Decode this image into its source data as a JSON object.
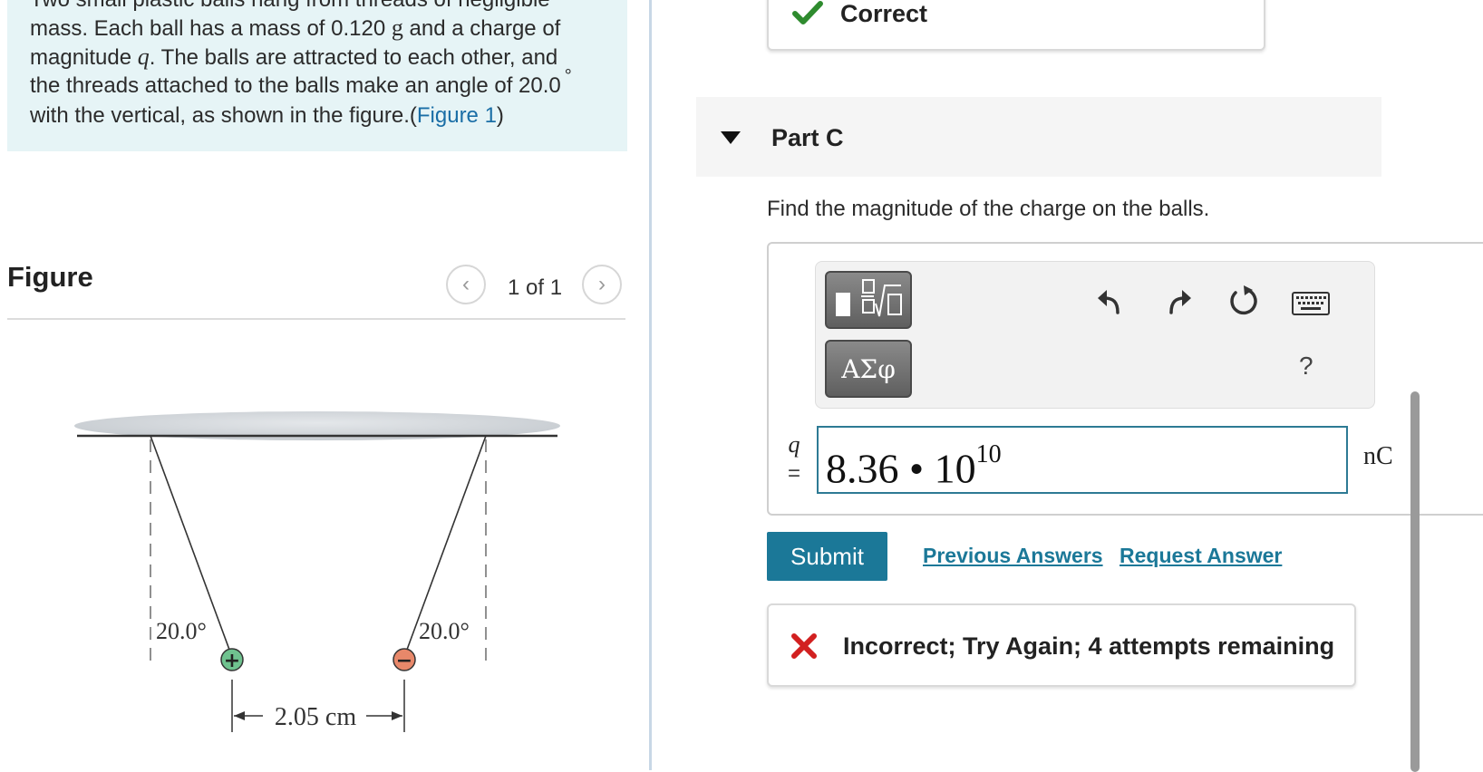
{
  "problem": {
    "line1": "Two small plastic balls hang from threads of negligible",
    "line2_a": "mass. Each ball has a mass of 0.120 ",
    "line2_unit": "g",
    "line2_b": " and a charge of",
    "line3_a": "magnitude ",
    "line3_var": "q",
    "line3_b": ". The balls are attracted to each other, and",
    "line4_a": "the threads attached to the balls make an angle of 20.0",
    "line4_deg": "°",
    "line5_a": "with the vertical, as shown in the figure.(",
    "line5_link": "Figure 1",
    "line5_b": ")"
  },
  "figure": {
    "heading": "Figure",
    "counter": "1 of 1",
    "angle_left": "20.0°",
    "angle_right": "20.0°",
    "distance": "2.05 cm",
    "charge_left": "+",
    "charge_right": "−",
    "colors": {
      "positive": "#6fc28f",
      "negative": "#e8886a",
      "ceiling": "#d0d4d8"
    }
  },
  "status_prev": {
    "text": "Correct",
    "color": "#2e8b2e"
  },
  "part": {
    "title": "Part C"
  },
  "question": "Find the magnitude of the charge on the balls.",
  "toolbar": {
    "greek_label": "ΑΣφ",
    "help_label": "?",
    "icons": [
      "templates-icon",
      "undo-icon",
      "redo-icon",
      "reset-icon",
      "keyboard-icon"
    ]
  },
  "answer": {
    "variable": "q",
    "equals": "=",
    "mantissa": "8.36 • 10",
    "exponent": "10",
    "unit": "nC"
  },
  "actions": {
    "submit": "Submit",
    "previous_answers": "Previous Answers",
    "request_answer": "Request Answer"
  },
  "feedback": {
    "text": "Incorrect; Try Again; 4 attempts remaining",
    "color": "#d22020"
  }
}
